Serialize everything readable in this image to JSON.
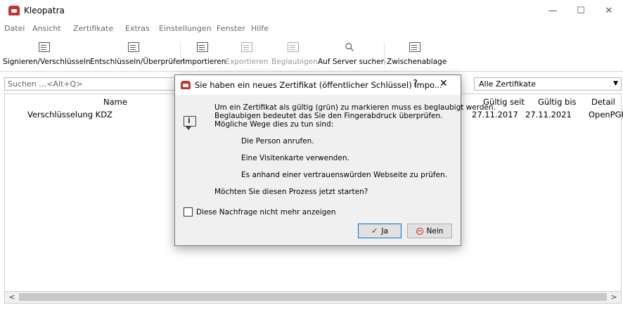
{
  "window": {
    "title": "Kleopatra",
    "minimize": "—",
    "maximize": "☐",
    "close": "✕"
  },
  "menu": [
    "Datei",
    "Ansicht",
    "Zertifikate",
    "Extras",
    "Einstellungen",
    "Fenster",
    "Hilfe"
  ],
  "toolbar": {
    "sign": "Signieren/Verschlüsseln",
    "decrypt": "Entschlüsseln/Überprüfen",
    "import": "Importieren",
    "export": "Exportieren",
    "certify": "Beglaubigen",
    "lookup": "Auf Server suchen",
    "clipboard": "Zwischenablage"
  },
  "search": {
    "placeholder": "Suchen …<Alt+Q>"
  },
  "filter": {
    "selected": "Alle Zertifikate",
    "arrow": "▼"
  },
  "table": {
    "headers": {
      "name": "Name",
      "valid_from": "Gültig seit",
      "valid_until": "Gültig bis",
      "details": "Detail"
    },
    "rows": [
      {
        "name": "Verschlüsselung KDZ",
        "valid_from": "27.11.2017",
        "valid_until": "27.11.2021",
        "details": "OpenPGF"
      }
    ]
  },
  "scroll": {
    "left": "<",
    "right": ">"
  },
  "dialog": {
    "title": "Sie haben ein neues Zertifikat (öffentlicher Schlüssel) impo...",
    "help": "?",
    "close": "✕",
    "line1": "Um ein Zertifikat als gültig (grün) zu markieren muss es beglaubigt werden.",
    "line2": "Beglaubigen bedeutet das Sie den Fingerabdruck überprüfen.",
    "line3": "Mögliche Wege dies zu tun sind:",
    "opt1": "Die Person anrufen.",
    "opt2": "Eine Visitenkarte verwenden.",
    "opt3": "Es anhand einer vertrauenswürden Webseite zu prüfen.",
    "question": "Möchten Sie diesen Prozess jetzt starten?",
    "checkbox": "Diese Nachfrage nicht mehr anzeigen",
    "yes": "Ja",
    "yes_icon": "✓",
    "no": "Nein"
  }
}
